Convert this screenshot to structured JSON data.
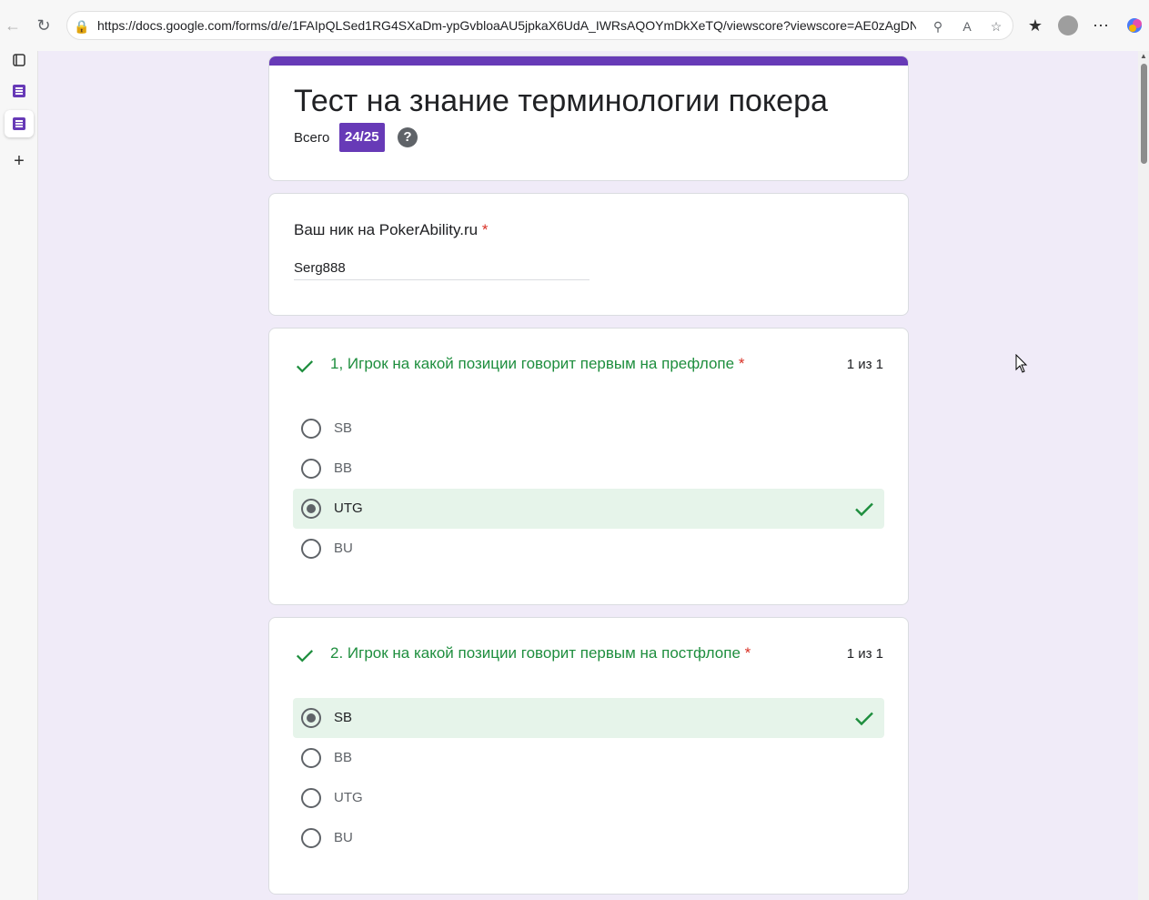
{
  "browser": {
    "url": "https://docs.google.com/forms/d/e/1FAIpQLSed1RG4SXaDm-ypGvbloaAU5jpkaX6UdA_IWRsAQOYmDkXeTQ/viewscore?viewscore=AE0zAgDN9..."
  },
  "header": {
    "title": "Тест на знание терминологии покера",
    "total_label": "Всего",
    "score": "24/25",
    "help_glyph": "?"
  },
  "nick": {
    "label": "Ваш ник на PokerAbility.ru",
    "required": "*",
    "value": "Serg888"
  },
  "questions": [
    {
      "title": "1, Игрок на какой позиции говорит первым на префлопе",
      "required": "*",
      "score": "1 из 1",
      "options": [
        "SB",
        "BB",
        "UTG",
        "BU"
      ],
      "selected": "UTG"
    },
    {
      "title": "2. Игрок на какой позиции говорит первым на постфлопе",
      "required": "*",
      "score": "1 из 1",
      "options": [
        "SB",
        "BB",
        "UTG",
        "BU"
      ],
      "selected": "SB"
    }
  ],
  "colors": {
    "accent": "#673ab7",
    "correct_text": "#1e8e3e",
    "correct_bg": "#e6f4ea",
    "page_bg": "#f0ebf8"
  }
}
